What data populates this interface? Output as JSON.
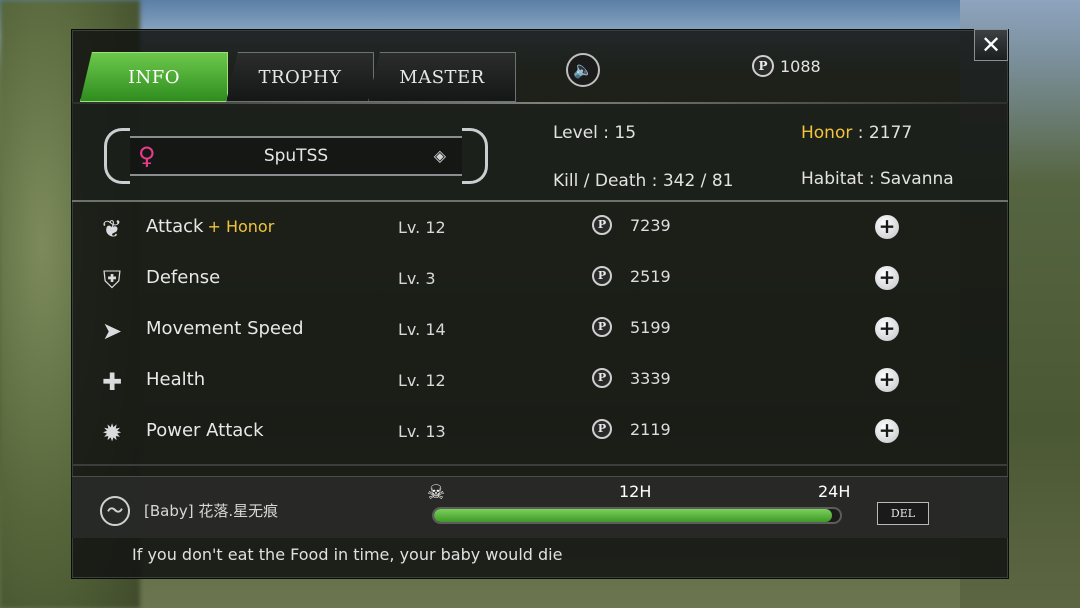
{
  "tabs": [
    {
      "label": "INFO",
      "active": true
    },
    {
      "label": "TROPHY",
      "active": false
    },
    {
      "label": "MASTER",
      "active": false
    }
  ],
  "header": {
    "coin_symbol": "P",
    "coins": "1088",
    "sound_icon": "speaker-icon",
    "close_label": "✕"
  },
  "profile": {
    "name": "SpuTSS",
    "gender_symbol": "♀",
    "level_label": "Level",
    "level": "15",
    "honor_label": "Honor",
    "honor": "2177",
    "kd_label": "Kill / Death",
    "kills": "342",
    "deaths": "81",
    "habitat_label": "Habitat",
    "habitat": "Savanna"
  },
  "upgrades": [
    {
      "name": "Attack",
      "bonus": "+ Honor",
      "level": "Lv. 12",
      "cost": "7239",
      "icon": "claw-icon"
    },
    {
      "name": "Defense",
      "bonus": "",
      "level": "Lv. 3",
      "cost": "2519",
      "icon": "shield-icon"
    },
    {
      "name": "Movement Speed",
      "bonus": "",
      "level": "Lv. 14",
      "cost": "5199",
      "icon": "wing-icon"
    },
    {
      "name": "Health",
      "bonus": "",
      "level": "Lv. 12",
      "cost": "3339",
      "icon": "cross-icon"
    },
    {
      "name": "Power Attack",
      "bonus": "",
      "level": "Lv. 13",
      "cost": "2119",
      "icon": "burst-icon"
    }
  ],
  "baby": {
    "name": "[Baby] 花落.星无痕",
    "time_12": "12H",
    "time_24": "24H",
    "progress": 0.98,
    "del_label": "DEL"
  },
  "footer": {
    "message": "If you don't eat the Food in time, your baby would die"
  },
  "colors": {
    "accent_green": "#4fb334",
    "honor_gold": "#f1c43b",
    "gender_pink": "#e83b8a"
  }
}
